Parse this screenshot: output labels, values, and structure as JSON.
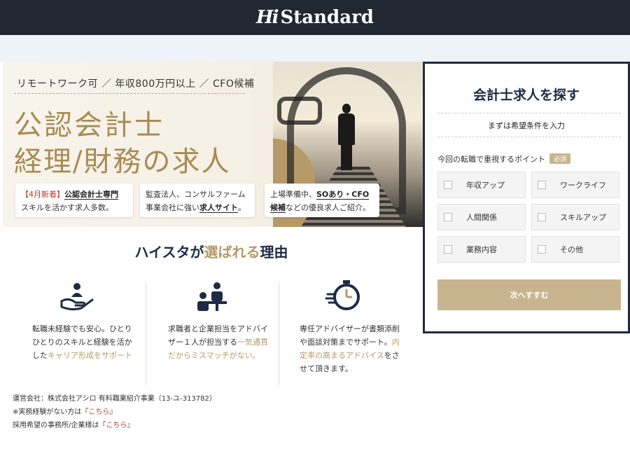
{
  "header": {
    "logo_mark": "Hi",
    "logo_text": "Standard",
    "bg": "#222831"
  },
  "hero": {
    "tagline": "リモートワーク可 ／ 年収800万円以上 ／ CFO候補",
    "title_line1": "公認会計士",
    "title_line2": "経理/財務の求人",
    "cards": [
      {
        "highlight": "【4月新着】",
        "bold": "公認会計士専門",
        "line2": "スキルを活かす求人多数。"
      },
      {
        "line1": "監査法人、コンサルファーム",
        "line2_pre": "事業会社に強い",
        "line2_bold": "求人サイト",
        "line2_post": "。"
      },
      {
        "line1_pre": "上場準備中、",
        "line1_bold": "SOあり・CFO",
        "line2_bold": "候補",
        "line2_post": "などの優良求人ご紹介。"
      }
    ]
  },
  "why": {
    "title_pre": "ハイスタが",
    "title_gold": "選ばれる",
    "title_post": "理由",
    "items": [
      {
        "icon": "hand-care-icon",
        "text_pre": "転職未経験でも安心。ひとりひとりのスキルと経験を活かした",
        "text_gold": "キャリア形成をサポート"
      },
      {
        "icon": "advisor-meeting-icon",
        "text_pre": "求職者と企業担当をアドバイザー１人が担当する",
        "text_gold": "一気通貫だからミスマッチがない。"
      },
      {
        "icon": "stopwatch-icon",
        "text_pre": "専任アドバイザーが書類添削や面談対策までサポート。",
        "text_gold": "内定率の高まるアドバイス",
        "text_post": "をさせて頂きます。"
      }
    ]
  },
  "footer": {
    "company": "運営会社：株式会社アシロ 有料職業紹介事業（13-ユ-313782）",
    "line2_pre": "※実務経験がない方は『",
    "line2_link": "こちら",
    "line2_post": "』",
    "line3_pre": "採用希望の事務所/企業様は『",
    "line3_link": "こちら",
    "line3_post": "』"
  },
  "search_panel": {
    "title": "会計士求人を探す",
    "subtitle": "まずは希望条件を入力",
    "question": "今回の転職で重視するポイント",
    "required_badge": "必須",
    "options": [
      "年収アップ",
      "ワークライフ",
      "人間関係",
      "スキルアップ",
      "業務内容",
      "その他"
    ],
    "next_label": "次へすすむ",
    "accent": "#c8b58f",
    "border": "#1f2a44"
  }
}
